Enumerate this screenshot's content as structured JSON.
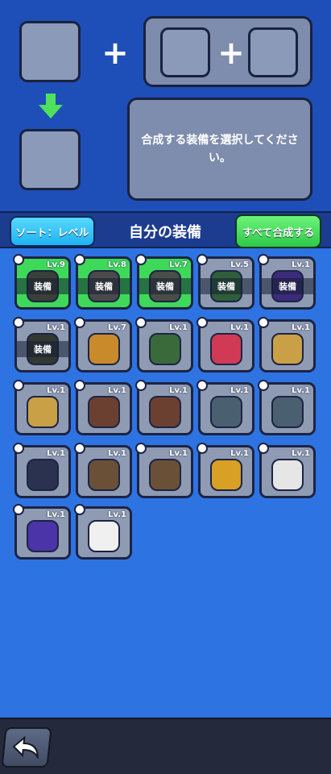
{
  "merge": {
    "hint": "合成する装備を選択してください。"
  },
  "header": {
    "sort_label": "ソート：レベル",
    "title": "自分の装備",
    "merge_all_label": "すべて合成する"
  },
  "items": [
    {
      "name": "armor-dark",
      "level": "Lv.9",
      "equipped": true,
      "equip_label": "装備",
      "slot_icon": "armor-icon"
    },
    {
      "name": "belt-dark",
      "level": "Lv.8",
      "equipped": true,
      "equip_label": "装備",
      "slot_icon": "belt-icon"
    },
    {
      "name": "gloves-dark",
      "level": "Lv.7",
      "equipped": true,
      "equip_label": "装備",
      "slot_icon": "glove-icon"
    },
    {
      "name": "bow-green",
      "level": "Lv.5",
      "equipped": true,
      "equip_label": "装備",
      "slot_icon": "weapon-icon",
      "gray": true
    },
    {
      "name": "ring-purple",
      "level": "Lv.1",
      "equipped": true,
      "equip_label": "装備",
      "slot_icon": "ring-icon",
      "gray": true
    },
    {
      "name": "boots-dark",
      "level": "Lv.1",
      "equipped": true,
      "equip_label": "装備",
      "slot_icon": "boot-icon",
      "gray": true
    },
    {
      "name": "axe",
      "level": "Lv.7",
      "equipped": false,
      "slot_icon": "weapon-icon"
    },
    {
      "name": "gauntlet-green",
      "level": "Lv.1",
      "equipped": false,
      "slot_icon": "glove-icon"
    },
    {
      "name": "gauntlet-red",
      "level": "Lv.1",
      "equipped": false,
      "slot_icon": "glove-icon"
    },
    {
      "name": "gauntlet-gold",
      "level": "Lv.1",
      "equipped": false,
      "slot_icon": "glove-icon"
    },
    {
      "name": "gauntlet-gold-2",
      "level": "Lv.1",
      "equipped": false,
      "slot_icon": "glove-icon"
    },
    {
      "name": "belt-green-gem",
      "level": "Lv.1",
      "equipped": false,
      "slot_icon": "belt-icon"
    },
    {
      "name": "belt-green-gem-2",
      "level": "Lv.1",
      "equipped": false,
      "slot_icon": "belt-icon"
    },
    {
      "name": "belt-steel",
      "level": "Lv.1",
      "equipped": false,
      "slot_icon": "belt-icon"
    },
    {
      "name": "belt-steel-2",
      "level": "Lv.1",
      "equipped": false,
      "slot_icon": "belt-icon"
    },
    {
      "name": "belt-skull",
      "level": "Lv.1",
      "equipped": false,
      "slot_icon": "belt-icon"
    },
    {
      "name": "armor-leather",
      "level": "Lv.1",
      "equipped": false,
      "slot_icon": "armor-icon"
    },
    {
      "name": "armor-leather-2",
      "level": "Lv.1",
      "equipped": false,
      "slot_icon": "armor-icon"
    },
    {
      "name": "armor-gold-purple",
      "level": "Lv.1",
      "equipped": false,
      "slot_icon": "armor-icon"
    },
    {
      "name": "armor-white",
      "level": "Lv.1",
      "equipped": false,
      "slot_icon": "armor-icon"
    },
    {
      "name": "boot-purple",
      "level": "Lv.1",
      "equipped": false,
      "slot_icon": "boot-icon"
    },
    {
      "name": "boot-white",
      "level": "Lv.1",
      "equipped": false,
      "slot_icon": "boot-icon"
    }
  ],
  "colors": {
    "equipped_bg": "#3fd95a",
    "slot_bg": "#8f9bb3",
    "panel_bg": "#1e4fb8",
    "page_bg": "#2e73e2"
  }
}
